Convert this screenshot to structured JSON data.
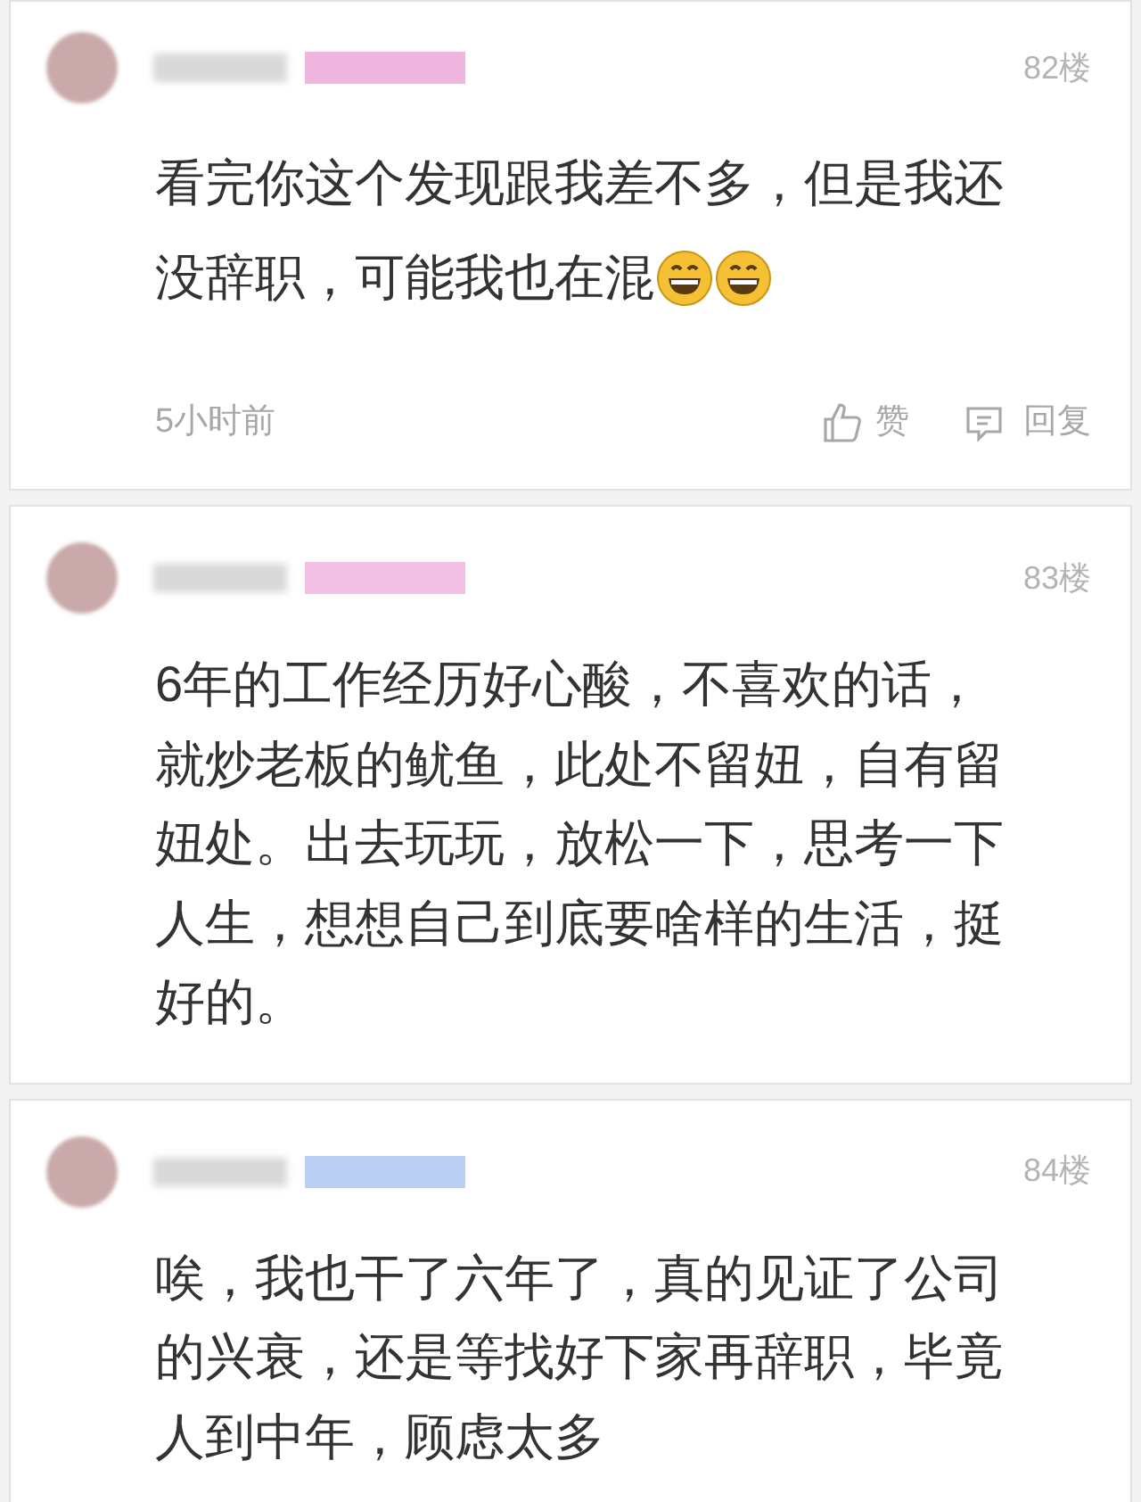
{
  "comments": [
    {
      "floor": "82楼",
      "color": "#eeb6de",
      "text_lines": [
        "看完你这个发现跟我差不多，但是我还",
        "没辞职，可能我也在混"
      ],
      "emojis": [
        {
          "kind": "grin"
        },
        {
          "kind": "grin"
        }
      ],
      "footer": {
        "time": "5小时前",
        "like": "赞",
        "reply": "回复"
      }
    },
    {
      "floor": "83楼",
      "color": "#f2c0e2",
      "text_lines": [
        "6年的工作经历好心酸，不喜欢的话，",
        "就炒老板的鱿鱼，此处不留妞，自有留",
        "妞处。出去玩玩，放松一下，思考一下",
        "人生，想想自己到底要啥样的生活，挺",
        "好的。"
      ]
    },
    {
      "floor": "84楼",
      "color": "#b9d0f2",
      "text_lines": [
        "唉，我也干了六年了，真的见证了公司",
        "的兴衰，还是等找好下家再辞职，毕竟",
        "人到中年，顾虑太多"
      ]
    }
  ]
}
